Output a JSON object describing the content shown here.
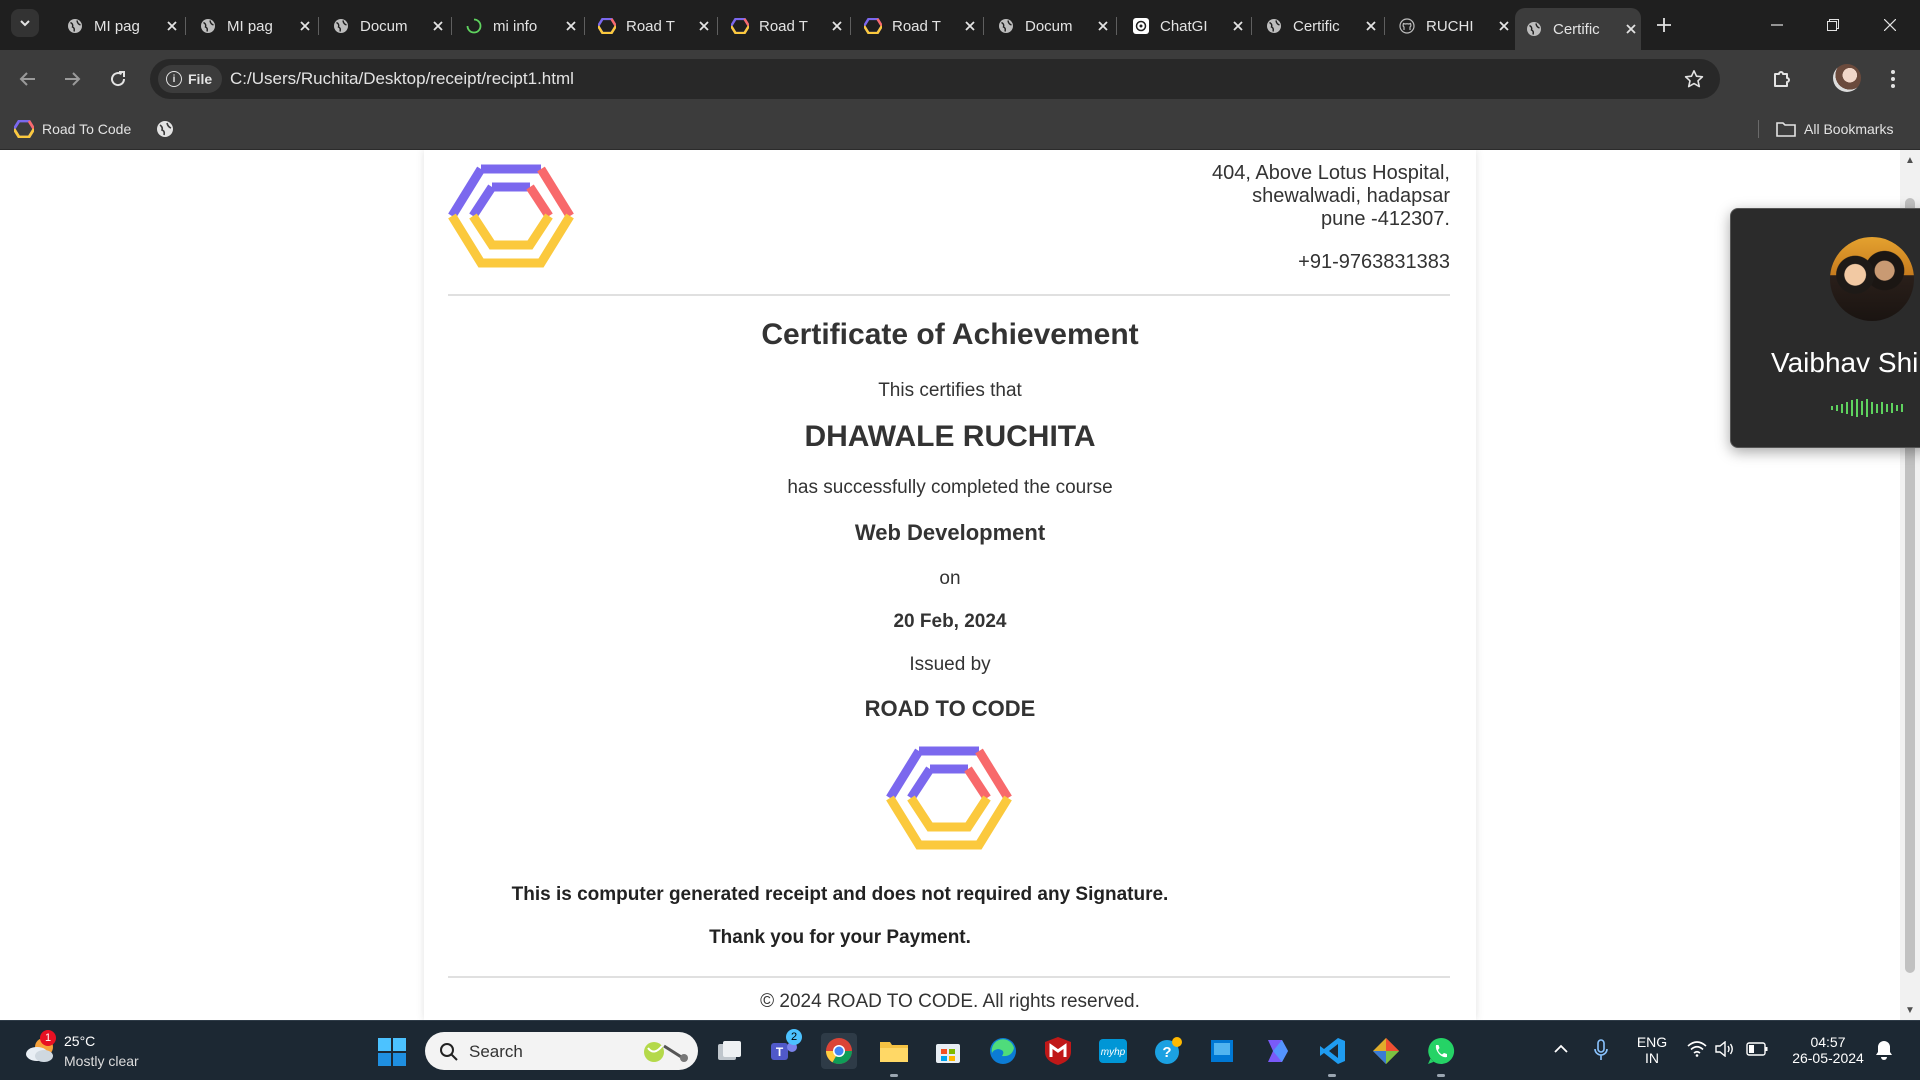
{
  "browser": {
    "tabs": [
      {
        "title": "MI pag",
        "favicon": "globe-icon"
      },
      {
        "title": "MI pag",
        "favicon": "globe-icon"
      },
      {
        "title": "Docum",
        "favicon": "globe-icon"
      },
      {
        "title": "mi info",
        "favicon": "loading-icon"
      },
      {
        "title": "Road T",
        "favicon": "road-to-code-logo"
      },
      {
        "title": "Road T",
        "favicon": "road-to-code-logo"
      },
      {
        "title": "Road T",
        "favicon": "road-to-code-logo"
      },
      {
        "title": "Docum",
        "favicon": "globe-icon"
      },
      {
        "title": "ChatGI",
        "favicon": "chatgpt-icon"
      },
      {
        "title": "Certific",
        "favicon": "globe-icon"
      },
      {
        "title": "RUCHI",
        "favicon": "github-icon"
      },
      {
        "title": "Certific",
        "favicon": "globe-icon",
        "active": true
      }
    ],
    "site_chip": "File",
    "url": "C:/Users/Ruchita/Desktop/receipt/recipt1.html",
    "bookmarks": [
      {
        "label": "Road To Code",
        "icon": "road-to-code-logo"
      },
      {
        "label": "",
        "icon": "globe-icon"
      }
    ],
    "all_bookmarks": "All Bookmarks"
  },
  "certificate": {
    "address_line1": "404, Above Lotus Hospital,",
    "address_line2": "shewalwadi, hadapsar",
    "address_line3": "pune -412307.",
    "phone": "+91-9763831383",
    "title": "Certificate of Achievement",
    "certifies": "This certifies that",
    "name": "DHAWALE RUCHITA",
    "completed": "has successfully completed the course",
    "course": "Web Development",
    "on": "on",
    "date": "20 Feb, 2024",
    "issued_by": "Issued by",
    "organization": "ROAD TO CODE",
    "note": "This is computer generated receipt and does not required any Signature.",
    "thanks": "Thank you for your Payment.",
    "copyright": "© 2024 ROAD TO CODE. All rights reserved.",
    "logo_colors": {
      "purple": "#7b68ee",
      "red": "#f8696b",
      "yellow": "#fbc93d"
    }
  },
  "call_card": {
    "name": "Vaibhav Shi"
  },
  "taskbar": {
    "weather": {
      "temp": "25°C",
      "condition": "Mostly clear",
      "badge": "1"
    },
    "search_label": "Search",
    "teams_badge": "2",
    "language_line1": "ENG",
    "language_line2": "IN",
    "time": "04:57",
    "date": "26-05-2024"
  }
}
